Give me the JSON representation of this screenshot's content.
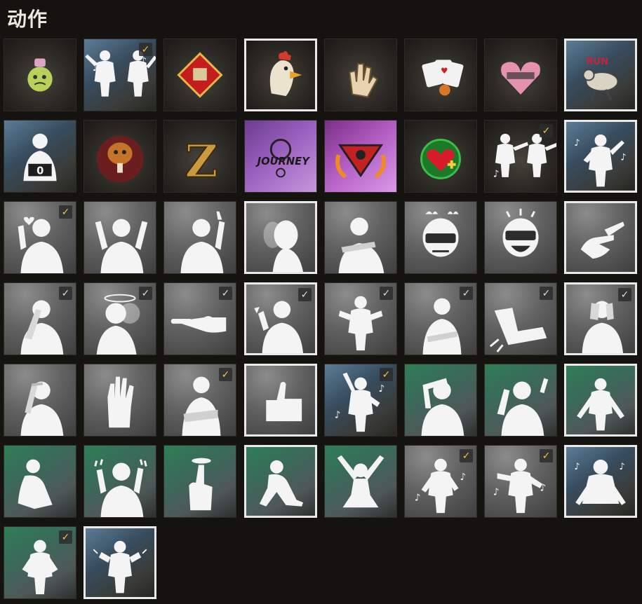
{
  "page_title": "动作",
  "colors": {
    "background": "#14130f",
    "check_yellow": "#f2c443",
    "check_white": "#dcdcdc",
    "selected_border": "#e9e9e9"
  },
  "items": [
    {
      "name": "emote-tile-potion-face",
      "bg": "dark",
      "icon": "cartoon-potion-face",
      "check": null,
      "selected": false
    },
    {
      "name": "emote-tile-dance-duo",
      "bg": "blue",
      "icon": "dancing-pair",
      "check": "yellow",
      "selected": false
    },
    {
      "name": "emote-tile-red-diamond-badge",
      "bg": "dark",
      "icon": "red-diamond-sign",
      "check": null,
      "selected": false
    },
    {
      "name": "emote-tile-chicken",
      "bg": "dark",
      "icon": "screaming-chicken",
      "check": null,
      "selected": true
    },
    {
      "name": "emote-tile-hand-sticker",
      "bg": "dark",
      "icon": "hand-gesture-sticker",
      "check": null,
      "selected": false
    },
    {
      "name": "emote-tile-cards",
      "bg": "dark",
      "icon": "playing-cards",
      "check": null,
      "selected": false
    },
    {
      "name": "emote-tile-crybaby",
      "bg": "dark",
      "icon": "crybaby-heart",
      "check": null,
      "selected": false
    },
    {
      "name": "emote-tile-run-chicken",
      "bg": "blue",
      "icon": "running-chicken",
      "check": null,
      "selected": true,
      "text": "RUN"
    },
    {
      "name": "emote-tile-scorecard",
      "bg": "blue",
      "icon": "scorecard-person",
      "check": null,
      "selected": false,
      "text": "0"
    },
    {
      "name": "emote-tile-winner-chicken",
      "bg": "dark",
      "icon": "winner-drumstick",
      "check": null,
      "selected": false
    },
    {
      "name": "emote-tile-letter-z",
      "bg": "dark",
      "icon": "letter-z",
      "check": null,
      "selected": false,
      "text": "Z"
    },
    {
      "name": "emote-tile-journey",
      "bg": "purple",
      "icon": "journey-logo",
      "check": null,
      "selected": false,
      "text": "JOURNEY"
    },
    {
      "name": "emote-tile-fire-emblem",
      "bg": "magenta",
      "icon": "fire-emblem",
      "check": null,
      "selected": false
    },
    {
      "name": "emote-tile-heal-heart",
      "bg": "dark",
      "icon": "heart-plus",
      "check": null,
      "selected": false
    },
    {
      "name": "emote-tile-dance-point",
      "bg": "dark",
      "icon": "pointing-dancers",
      "check": "yellow",
      "selected": false
    },
    {
      "name": "emote-tile-air-guitar",
      "bg": "blue",
      "icon": "air-guitar",
      "check": null,
      "selected": true
    },
    {
      "name": "emote-tile-heart-hand",
      "bg": "gray",
      "icon": "heart-hand",
      "check": "yellow",
      "selected": false
    },
    {
      "name": "emote-tile-hands-up",
      "bg": "gray",
      "icon": "hands-up",
      "check": null,
      "selected": false
    },
    {
      "name": "emote-tile-wave",
      "bg": "gray",
      "icon": "waving",
      "check": null,
      "selected": false
    },
    {
      "name": "emote-tile-head-turn",
      "bg": "gray",
      "icon": "head-turn",
      "check": null,
      "selected": true
    },
    {
      "name": "emote-tile-lean-rest",
      "bg": "gray",
      "icon": "lean-rest",
      "check": null,
      "selected": false
    },
    {
      "name": "emote-tile-helmet-angry",
      "bg": "gray",
      "icon": "helmet-angry",
      "check": null,
      "selected": false
    },
    {
      "name": "emote-tile-helmet-laugh",
      "bg": "gray",
      "icon": "helmet-laugh",
      "check": null,
      "selected": false
    },
    {
      "name": "emote-tile-clap",
      "bg": "gray",
      "icon": "clapping-hands",
      "check": null,
      "selected": true
    },
    {
      "name": "emote-tile-facepalm",
      "bg": "gray",
      "icon": "facepalm",
      "check": "white",
      "selected": false
    },
    {
      "name": "emote-tile-dizzy",
      "bg": "gray",
      "icon": "dizzy-head",
      "check": "white",
      "selected": false
    },
    {
      "name": "emote-tile-point",
      "bg": "gray",
      "icon": "pointing-hand",
      "check": "white",
      "selected": false
    },
    {
      "name": "emote-tile-shrug-one",
      "bg": "gray",
      "icon": "shrug-side",
      "check": "white",
      "selected": true
    },
    {
      "name": "emote-tile-shrug",
      "bg": "gray",
      "icon": "shrug",
      "check": "white",
      "selected": false
    },
    {
      "name": "emote-tile-sad",
      "bg": "gray",
      "icon": "sad-arms-crossed",
      "check": "white",
      "selected": false
    },
    {
      "name": "emote-tile-kick",
      "bg": "gray",
      "icon": "kick-boot",
      "check": "white",
      "selected": false
    },
    {
      "name": "emote-tile-cover-face",
      "bg": "gray",
      "icon": "cover-face",
      "check": "white",
      "selected": true
    },
    {
      "name": "emote-tile-salute",
      "bg": "gray",
      "icon": "salute",
      "check": null,
      "selected": false
    },
    {
      "name": "emote-tile-stop-hand",
      "bg": "gray",
      "icon": "open-palm",
      "check": null,
      "selected": false
    },
    {
      "name": "emote-tile-arms-crossed",
      "bg": "gray",
      "icon": "arms-crossed",
      "check": "yellow",
      "selected": false
    },
    {
      "name": "emote-tile-thumbs-up",
      "bg": "gray",
      "icon": "thumbs-up",
      "check": null,
      "selected": true
    },
    {
      "name": "emote-tile-dance-point-up",
      "bg": "blue",
      "icon": "disco-point",
      "check": "yellow",
      "selected": false
    },
    {
      "name": "emote-tile-hair-flip",
      "bg": "green",
      "icon": "hair-flip",
      "check": null,
      "selected": false
    },
    {
      "name": "emote-tile-block",
      "bg": "green",
      "icon": "arm-block",
      "check": null,
      "selected": false
    },
    {
      "name": "emote-tile-flex-pose",
      "bg": "green",
      "icon": "open-arms",
      "check": null,
      "selected": true
    },
    {
      "name": "emote-tile-kneel-pray",
      "bg": "green",
      "icon": "kneel-pray",
      "check": null,
      "selected": false
    },
    {
      "name": "emote-tile-rock-on",
      "bg": "green",
      "icon": "rock-on",
      "check": null,
      "selected": false
    },
    {
      "name": "emote-tile-finger-twirl",
      "bg": "green",
      "icon": "finger-twirl",
      "check": null,
      "selected": false
    },
    {
      "name": "emote-tile-kneel",
      "bg": "green",
      "icon": "kneel",
      "check": null,
      "selected": true
    },
    {
      "name": "emote-tile-victory-kneel",
      "bg": "green",
      "icon": "victory-kneel",
      "check": null,
      "selected": false
    },
    {
      "name": "emote-tile-dance-twist",
      "bg": "gray",
      "icon": "dance-twist",
      "check": "yellow",
      "selected": false
    },
    {
      "name": "emote-tile-dance-wiggle",
      "bg": "gray",
      "icon": "dance-wiggle",
      "check": "yellow",
      "selected": false
    },
    {
      "name": "emote-tile-floor-dance",
      "bg": "blue",
      "icon": "floor-dance",
      "check": null,
      "selected": true
    },
    {
      "name": "emote-tile-hips-stand",
      "bg": "green",
      "icon": "hands-on-hips",
      "check": "yellow",
      "selected": false
    },
    {
      "name": "emote-tile-flex-stand",
      "bg": "blue",
      "icon": "flex-stand",
      "check": null,
      "selected": true
    }
  ]
}
